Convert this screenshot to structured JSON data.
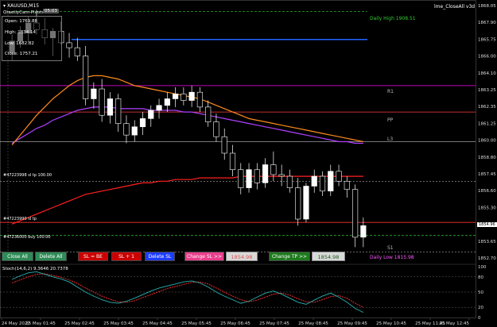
{
  "symbol_title": "XAUUSD,M15",
  "indicator_name": "lme_CloseAll v3d",
  "subtitle": "QtaetlyCam-Pivots.",
  "timer_badge": "05:03",
  "ohlc": {
    "open": "Open: 1769.88",
    "high": "High: 1834.14",
    "low": "Low: 1682.82",
    "close": "Close: 1757.21"
  },
  "levels": {
    "daily_high": "Daily High 1908.51",
    "daily_low": "Daily Low 1815.98",
    "r1": "R1",
    "pp": "PP",
    "s1": "S1",
    "l3": "L3"
  },
  "order_labels": {
    "order1": "#47223998 sl tp 100.00",
    "order2": "#47223990 sl tp",
    "order3": "#47236000 buy 100.00"
  },
  "current_price_badge": "1854.96",
  "price_axis": [
    "1868.05",
    "1867.90",
    "1865.75",
    "1866.00",
    "1864.10",
    "1863.25",
    "1862.35",
    "1861.25",
    "1860.00",
    "1858.80",
    "1857.45",
    "1856.60",
    "1855.30",
    "1854.85",
    "1853.65",
    "1852.70"
  ],
  "buttons": {
    "close_all": "Close All",
    "delete_all": "Delete All",
    "sl_be": "SL = BE",
    "sl_plus1": "SL + 1",
    "delete_sl": "Delete SL",
    "change_sl": "Change SL >>",
    "sl_value": "1854.98",
    "change_tp": "Change TP >>",
    "tp_value": "1854.98"
  },
  "stoch_label": "Stoch(14,6,2) 9.3646 20.7378",
  "stoch_axis": [
    "100",
    "80",
    "50",
    "20",
    "0"
  ],
  "time_axis": [
    "24 May 2022",
    "25 May 01:45",
    "25 May 02:45",
    "25 May 03:45",
    "25 May 04:45",
    "25 May 05:45",
    "25 May 06:45",
    "25 May 07:45",
    "25 May 08:45",
    "25 May 09:45",
    "25 May 10:45",
    "25 May 11:45",
    "25 May 12:45"
  ],
  "colors": {
    "background": "#000000",
    "bull_candle": "#ffffff",
    "bear_candle": "#000000",
    "ma_fast": "#ff8c1a",
    "ma_mid": "#b040ff",
    "ma_slow": "#ff2020",
    "level_high": "#33cc33",
    "level_r1": "#ff00ff",
    "level_pp": "#ff4040",
    "level_l3": "#c0c0c0",
    "level_blue": "#2266ff",
    "close_all_btn": "#2e8b57",
    "red_btn": "#cc0000",
    "blue_btn": "#1e3cff",
    "pink_btn": "#e83e8c",
    "green_btn": "#1f7a1f"
  },
  "chart_data": {
    "type": "candlestick",
    "title": "XAUUSD,M15",
    "candles": [
      {
        "o": 1865.4,
        "h": 1866.5,
        "l": 1864.9,
        "c": 1866.1
      },
      {
        "o": 1866.1,
        "h": 1867.0,
        "l": 1865.7,
        "c": 1866.6
      },
      {
        "o": 1866.6,
        "h": 1867.6,
        "l": 1866.0,
        "c": 1867.2
      },
      {
        "o": 1867.2,
        "h": 1868.0,
        "l": 1866.5,
        "c": 1866.8
      },
      {
        "o": 1866.8,
        "h": 1867.5,
        "l": 1865.9,
        "c": 1866.3
      },
      {
        "o": 1866.3,
        "h": 1866.9,
        "l": 1865.2,
        "c": 1866.7
      },
      {
        "o": 1866.7,
        "h": 1867.3,
        "l": 1865.9,
        "c": 1866.0
      },
      {
        "o": 1866.0,
        "h": 1866.6,
        "l": 1865.1,
        "c": 1865.7
      },
      {
        "o": 1865.7,
        "h": 1866.3,
        "l": 1864.9,
        "c": 1865.2
      },
      {
        "o": 1865.2,
        "h": 1865.8,
        "l": 1862.2,
        "c": 1862.6
      },
      {
        "o": 1862.6,
        "h": 1863.6,
        "l": 1862.0,
        "c": 1863.2
      },
      {
        "o": 1863.2,
        "h": 1863.8,
        "l": 1861.2,
        "c": 1861.6
      },
      {
        "o": 1861.6,
        "h": 1863.0,
        "l": 1861.1,
        "c": 1862.6
      },
      {
        "o": 1862.6,
        "h": 1862.9,
        "l": 1860.6,
        "c": 1861.1
      },
      {
        "o": 1861.1,
        "h": 1861.6,
        "l": 1859.9,
        "c": 1860.4
      },
      {
        "o": 1860.4,
        "h": 1861.3,
        "l": 1860.0,
        "c": 1860.9
      },
      {
        "o": 1860.9,
        "h": 1861.8,
        "l": 1860.4,
        "c": 1861.4
      },
      {
        "o": 1861.4,
        "h": 1862.2,
        "l": 1860.9,
        "c": 1861.9
      },
      {
        "o": 1861.9,
        "h": 1862.6,
        "l": 1861.4,
        "c": 1862.2
      },
      {
        "o": 1862.2,
        "h": 1863.0,
        "l": 1861.8,
        "c": 1862.6
      },
      {
        "o": 1862.6,
        "h": 1863.3,
        "l": 1862.1,
        "c": 1862.9
      },
      {
        "o": 1862.9,
        "h": 1863.3,
        "l": 1862.2,
        "c": 1862.5
      },
      {
        "o": 1862.5,
        "h": 1863.4,
        "l": 1862.1,
        "c": 1863.0
      },
      {
        "o": 1863.0,
        "h": 1863.3,
        "l": 1861.8,
        "c": 1862.1
      },
      {
        "o": 1862.1,
        "h": 1862.5,
        "l": 1860.9,
        "c": 1861.2
      },
      {
        "o": 1861.2,
        "h": 1861.7,
        "l": 1860.0,
        "c": 1860.3
      },
      {
        "o": 1860.3,
        "h": 1860.8,
        "l": 1858.9,
        "c": 1859.3
      },
      {
        "o": 1859.3,
        "h": 1859.8,
        "l": 1857.9,
        "c": 1858.3
      },
      {
        "o": 1858.3,
        "h": 1858.7,
        "l": 1856.8,
        "c": 1857.2
      },
      {
        "o": 1857.2,
        "h": 1858.7,
        "l": 1856.9,
        "c": 1858.3
      },
      {
        "o": 1858.3,
        "h": 1858.7,
        "l": 1857.1,
        "c": 1857.5
      },
      {
        "o": 1857.5,
        "h": 1859.0,
        "l": 1857.2,
        "c": 1858.6
      },
      {
        "o": 1858.6,
        "h": 1859.4,
        "l": 1857.6,
        "c": 1858.0
      },
      {
        "o": 1858.0,
        "h": 1858.6,
        "l": 1857.3,
        "c": 1857.9
      },
      {
        "o": 1857.9,
        "h": 1858.3,
        "l": 1856.9,
        "c": 1857.2
      },
      {
        "o": 1857.2,
        "h": 1857.8,
        "l": 1854.9,
        "c": 1855.3
      },
      {
        "o": 1855.3,
        "h": 1857.5,
        "l": 1855.1,
        "c": 1857.3
      },
      {
        "o": 1857.3,
        "h": 1858.3,
        "l": 1856.9,
        "c": 1857.9
      },
      {
        "o": 1857.9,
        "h": 1858.2,
        "l": 1856.7,
        "c": 1857.0
      },
      {
        "o": 1857.0,
        "h": 1858.6,
        "l": 1856.7,
        "c": 1858.2
      },
      {
        "o": 1858.2,
        "h": 1858.6,
        "l": 1857.3,
        "c": 1857.6
      },
      {
        "o": 1857.6,
        "h": 1857.9,
        "l": 1856.6,
        "c": 1857.1
      },
      {
        "o": 1857.1,
        "h": 1857.4,
        "l": 1853.6,
        "c": 1854.2
      },
      {
        "o": 1854.2,
        "h": 1855.4,
        "l": 1853.6,
        "c": 1854.9
      }
    ],
    "ma_fast": [
      1859.8,
      1860.4,
      1861.0,
      1861.6,
      1862.1,
      1862.6,
      1863.0,
      1863.4,
      1863.7,
      1863.9,
      1864.0,
      1864.0,
      1863.9,
      1863.8,
      1863.6,
      1863.4,
      1863.3,
      1863.2,
      1863.1,
      1863.0,
      1862.9,
      1862.8,
      1862.7,
      1862.6,
      1862.4,
      1862.2,
      1862.0,
      1861.8,
      1861.6,
      1861.4,
      1861.3,
      1861.2,
      1861.1,
      1861.0,
      1860.9,
      1860.8,
      1860.7,
      1860.6,
      1860.5,
      1860.4,
      1860.3,
      1860.2,
      1860.1,
      1860.0
    ],
    "ma_mid": [
      1859.9,
      1860.2,
      1860.5,
      1860.8,
      1861.0,
      1861.3,
      1861.5,
      1861.7,
      1861.9,
      1862.0,
      1862.1,
      1862.1,
      1862.1,
      1862.0,
      1862.0,
      1862.0,
      1862.0,
      1861.9,
      1861.9,
      1861.9,
      1861.9,
      1861.8,
      1861.8,
      1861.7,
      1861.6,
      1861.5,
      1861.4,
      1861.3,
      1861.2,
      1861.1,
      1861.0,
      1860.9,
      1860.8,
      1860.7,
      1860.6,
      1860.5,
      1860.4,
      1860.3,
      1860.2,
      1860.1,
      1860.0,
      1860.0,
      1859.9,
      1859.9
    ],
    "ma_slow": [
      1855.0,
      1855.2,
      1855.4,
      1855.6,
      1855.8,
      1856.0,
      1856.2,
      1856.4,
      1856.6,
      1856.8,
      1856.9,
      1857.0,
      1857.1,
      1857.2,
      1857.3,
      1857.4,
      1857.5,
      1857.5,
      1857.6,
      1857.6,
      1857.7,
      1857.7,
      1857.7,
      1857.8,
      1857.8,
      1857.8,
      1857.8,
      1857.8,
      1857.9,
      1857.9,
      1857.9,
      1857.9,
      1857.9,
      1857.9,
      1857.9,
      1857.9,
      1857.9,
      1857.9,
      1857.9,
      1857.9,
      1857.9,
      1857.9,
      1857.9,
      1857.9
    ],
    "levels": {
      "daily_high": 1867.9,
      "blue": 1866.2,
      "r1": 1863.4,
      "pp": 1861.8,
      "l3": 1860.0,
      "order_line": 1857.6,
      "current": 1855.1,
      "order_line2": 1854.3,
      "s1": 1853.3
    },
    "stoch_main": [
      75,
      82,
      88,
      90,
      85,
      80,
      76,
      70,
      60,
      50,
      42,
      35,
      30,
      28,
      32,
      38,
      45,
      52,
      58,
      62,
      66,
      70,
      72,
      68,
      60,
      50,
      42,
      35,
      28,
      32,
      40,
      48,
      52,
      46,
      38,
      30,
      26,
      34,
      42,
      48,
      40,
      30,
      18,
      10
    ],
    "stoch_signal": [
      68,
      74,
      80,
      85,
      86,
      83,
      79,
      74,
      67,
      58,
      50,
      42,
      36,
      31,
      30,
      33,
      39,
      45,
      51,
      57,
      61,
      65,
      69,
      70,
      66,
      58,
      50,
      42,
      35,
      31,
      34,
      40,
      46,
      48,
      44,
      37,
      31,
      30,
      35,
      41,
      43,
      38,
      28,
      20
    ],
    "ylim": [
      1852.7,
      1868.5
    ],
    "stoch_ylim": [
      0,
      100
    ]
  }
}
